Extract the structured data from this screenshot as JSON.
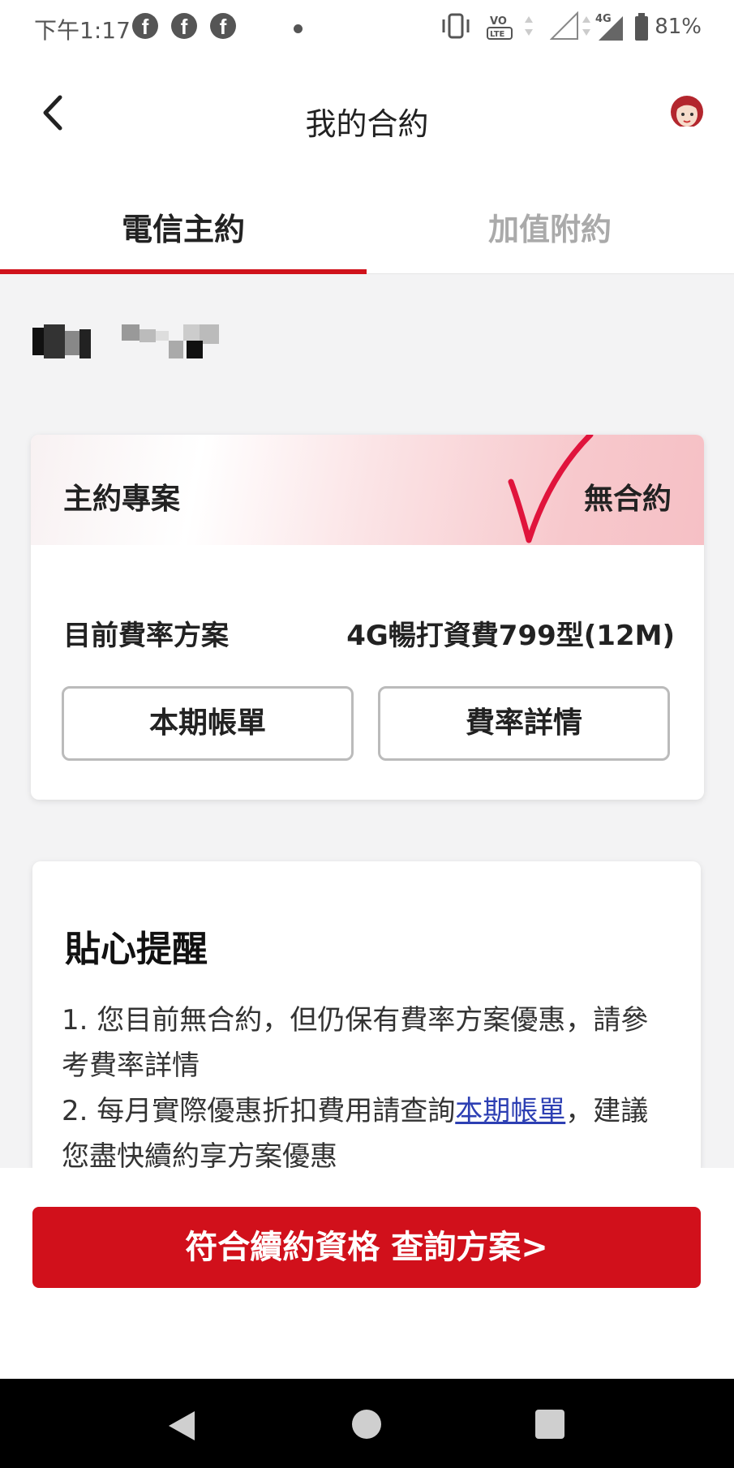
{
  "status_bar": {
    "time": "下午1:17",
    "battery": "81%",
    "network": "4G",
    "volte": "VoLTE",
    "icons": [
      "facebook-icon",
      "facebook-icon",
      "facebook-icon",
      "vibrate-icon",
      "volte-icon",
      "signal-icon",
      "battery-icon"
    ]
  },
  "header": {
    "title": "我的合約",
    "back_icon": "chevron-left-icon",
    "avatar_icon": "avatar-icon"
  },
  "tabs": [
    {
      "label": "電信主約",
      "active": true
    },
    {
      "label": "加值附約",
      "active": false
    }
  ],
  "colors": {
    "accent": "#d1101b",
    "link": "#2d3fb3",
    "background": "#f3f3f4"
  },
  "contract_card": {
    "label": "主約專案",
    "status": "無合約",
    "rate_label": "目前費率方案",
    "rate_value": "4G暢打資費799型(12M)",
    "bill_button": "本期帳單",
    "rate_button": "費率詳情"
  },
  "reminder": {
    "title": "貼心提醒",
    "line1": "1. 您目前無合約，但仍保有費率方案優惠，請參考費率詳情",
    "line2_prefix": "2. 每月實際優惠折扣費用請查詢",
    "line2_link": "本期帳單",
    "line2_suffix": "，建議您盡快續約享方案優惠"
  },
  "cta": {
    "label": "符合續約資格 查詢方案>"
  }
}
